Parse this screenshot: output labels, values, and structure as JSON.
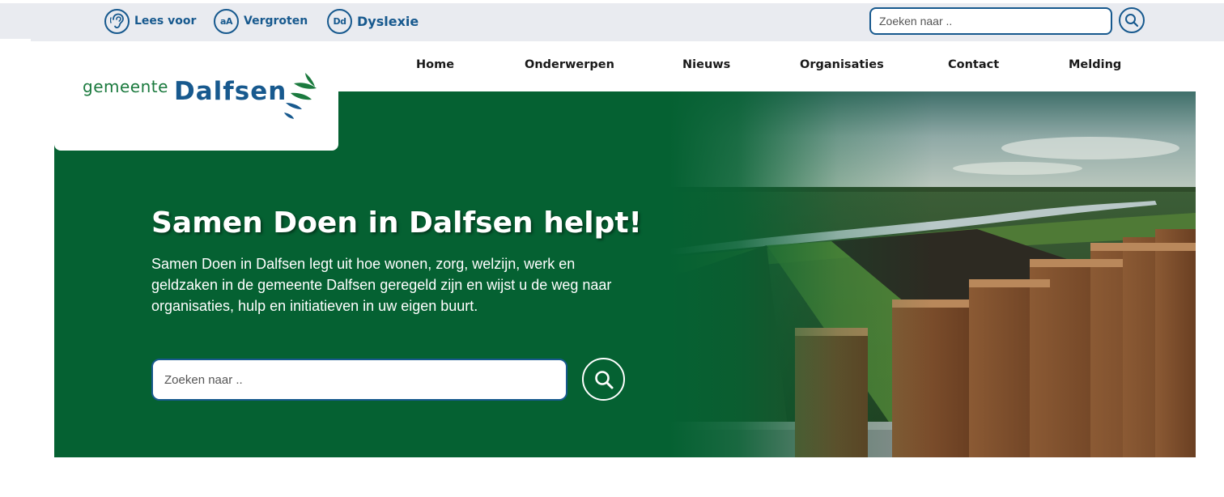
{
  "utility": {
    "read_aloud": {
      "label": "Lees voor",
      "icon": "ear-icon"
    },
    "enlarge": {
      "label": "Vergroten",
      "icon_text": "aA"
    },
    "dyslexia": {
      "label": "Dyslexie",
      "icon_text": "Dd"
    }
  },
  "top_search": {
    "placeholder": "Zoeken naar ..",
    "button_icon": "search-icon"
  },
  "logo": {
    "word1": "gemeente",
    "word2": "Dalfsen"
  },
  "nav": {
    "items": [
      {
        "label": "Home"
      },
      {
        "label": "Onderwerpen"
      },
      {
        "label": "Nieuws"
      },
      {
        "label": "Organisaties"
      },
      {
        "label": "Contact"
      },
      {
        "label": "Melding"
      }
    ]
  },
  "hero": {
    "title": "Samen Doen in Dalfsen helpt!",
    "text": "Samen Doen in Dalfsen legt uit hoe wonen, zorg, welzijn, werk en geldzaken in de gemeente Dalfsen geregeld zijn en wijst u de weg naar organisaties, hulp en initiatieven in uw eigen buurt.",
    "search_placeholder": "Zoeken naar .."
  },
  "colors": {
    "brand_green": "#056132",
    "brand_blue": "#17598e",
    "topbar_bg": "#e9ebf0"
  }
}
